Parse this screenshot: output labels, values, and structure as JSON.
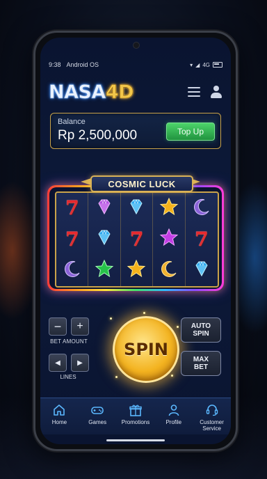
{
  "status_bar": {
    "time": "9:38",
    "os": "Android OS",
    "network": "4G"
  },
  "header": {
    "logo_main": "NASA",
    "logo_accent": "4D"
  },
  "balance": {
    "label": "Balance",
    "value": "Rp 2,500,000",
    "topup_label": "Top Up"
  },
  "game": {
    "title": "COSMIC LUCK",
    "reels": [
      [
        "seven",
        "gem-purple",
        "gem-blue",
        "star-gold",
        "moon-purple"
      ],
      [
        "seven",
        "gem-blue",
        "seven",
        "star-purple",
        "seven"
      ],
      [
        "moon-purple",
        "star-green",
        "star-gold",
        "moon-gold",
        "gem-blue"
      ]
    ],
    "seven_glyph": "7"
  },
  "controls": {
    "minus": "−",
    "plus": "+",
    "bet_amount_label": "BET AMOUNT",
    "prev": "◀",
    "next": "▶",
    "lines_label": "LINES",
    "spin_label": "SPIN",
    "auto_spin_label": "AUTO\nSPIN",
    "max_bet_label": "MAX\nBET"
  },
  "nav": {
    "items": [
      {
        "label": "Home",
        "icon": "home-icon"
      },
      {
        "label": "Games",
        "icon": "gamepad-icon"
      },
      {
        "label": "Promotions",
        "icon": "gift-icon"
      },
      {
        "label": "Profile",
        "icon": "user-icon"
      },
      {
        "label": "Customer\nService",
        "icon": "headset-icon"
      }
    ]
  },
  "colors": {
    "accent_gold": "#d9b257",
    "topup_green": "#2fae4f",
    "background": "#0a1430"
  }
}
